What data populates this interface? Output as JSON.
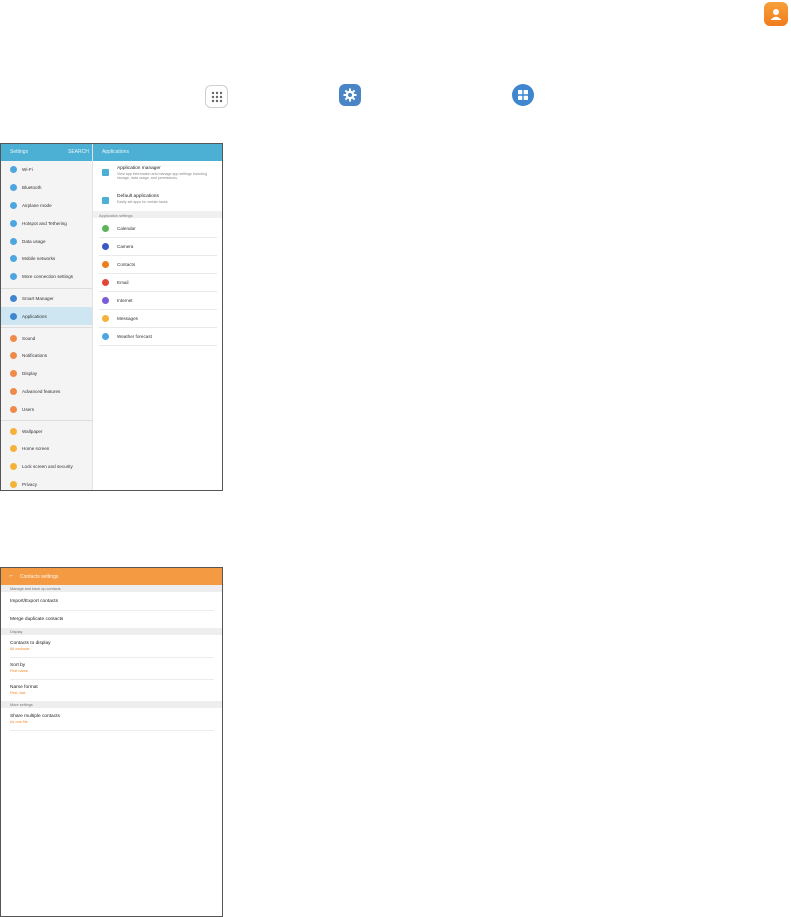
{
  "guide_icons": {
    "contacts_color": "#f07c1c",
    "settings_color": "#4a86c5",
    "applications_color": "#3f86cf"
  },
  "settings_screen": {
    "header_title": "Settings",
    "search_label": "SEARCH",
    "right_title": "Applications",
    "groups": [
      [
        {
          "label": "Wi-Fi",
          "color": "#4da6e0"
        },
        {
          "label": "Bluetooth",
          "color": "#4da6e0"
        },
        {
          "label": "Airplane mode",
          "color": "#4da6e0"
        },
        {
          "label": "Hotspot and Tethering",
          "color": "#4da6e0"
        },
        {
          "label": "Data usage",
          "color": "#4da6e0"
        },
        {
          "label": "Mobile networks",
          "color": "#4da6e0"
        },
        {
          "label": "More connection settings",
          "color": "#4da6e0"
        }
      ],
      [
        {
          "label": "Smart Manager",
          "color": "#3f86cf"
        },
        {
          "label": "Applications",
          "color": "#3f86cf",
          "selected": true
        }
      ],
      [
        {
          "label": "Sound",
          "color": "#f08a4a"
        },
        {
          "label": "Notifications",
          "color": "#f08a4a"
        },
        {
          "label": "Display",
          "color": "#f08a4a"
        },
        {
          "label": "Advanced features",
          "color": "#f08a4a"
        },
        {
          "label": "Users",
          "color": "#f08a4a"
        }
      ],
      [
        {
          "label": "Wallpaper",
          "color": "#f4b23a"
        },
        {
          "label": "Home screen",
          "color": "#f4b23a"
        },
        {
          "label": "Lock screen and security",
          "color": "#f4b23a"
        },
        {
          "label": "Privacy",
          "color": "#f4b23a"
        }
      ]
    ],
    "app_manager": {
      "title": "Application manager",
      "desc": "View app information and manage app settings including storage, data usage, and permissions."
    },
    "default_apps": {
      "title": "Default applications",
      "desc": "Easily set apps for certain tasks."
    },
    "app_settings_label": "Application settings",
    "apps": [
      {
        "label": "Calendar",
        "color": "#5ab55a"
      },
      {
        "label": "Camera",
        "color": "#3a58c4"
      },
      {
        "label": "Contacts",
        "color": "#f07c1c"
      },
      {
        "label": "Email",
        "color": "#e2453a"
      },
      {
        "label": "Internet",
        "color": "#7a5cd8"
      },
      {
        "label": "Messages",
        "color": "#f4b23a"
      },
      {
        "label": "Weather forecast",
        "color": "#4da6e0"
      }
    ]
  },
  "contacts_screen": {
    "title": "Contacts settings",
    "sections": [
      {
        "header": "Manage and back up contacts",
        "items": [
          {
            "title": "Import/Export contacts"
          },
          {
            "title": "Merge duplicate contacts"
          }
        ]
      },
      {
        "header": "Display",
        "items": [
          {
            "title": "Contacts to display",
            "sub": "All contacts"
          },
          {
            "title": "Sort by",
            "sub": "First name"
          },
          {
            "title": "Name format",
            "sub": "First, last"
          }
        ]
      },
      {
        "header": "More settings",
        "items": [
          {
            "title": "Share multiple contacts",
            "sub": "As one file"
          }
        ]
      }
    ]
  }
}
